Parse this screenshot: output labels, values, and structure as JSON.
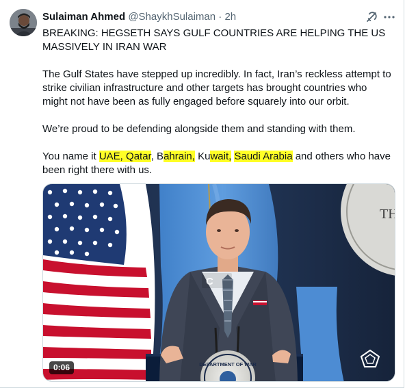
{
  "tweet": {
    "author_name": "Sulaiman Ahmed",
    "handle": "@ShaykhSulaiman",
    "separator": "·",
    "time": "2h",
    "headline_line1": "BREAKING: HEGSETH SAYS GULF COUNTRIES ARE HELPING THE US",
    "headline_line2": "MASSIVELY IN IRAN WAR",
    "paragraph1": "The Gulf States have stepped up incredibly. In fact, Iran’s reckless attempt to strike civilian infrastructure and other targets has brought countries who might not have been as fully engaged before squarely into our orbit.",
    "paragraph2": "We’re proud to be defending alongside them and standing with them.",
    "p3": {
      "t1": "You name it ",
      "h1": "UAE, Qatar",
      "t2": ", B",
      "h2": "ahrain,",
      "t3": " Ku",
      "h3": "wait,",
      "t4": " ",
      "h4": "Saudi Arabia",
      "t5": " and others who have been right there with us."
    }
  },
  "video": {
    "timestamp": "0:06",
    "watermark": "C",
    "backdrop_letter": "TH",
    "seal_text": "DEPARTMENT OF WAR"
  },
  "icons": {
    "grok": "grok-icon",
    "more": "more-options-icon",
    "seal": "department-seal-icon",
    "pentagon": "pentagon-logo-icon"
  },
  "colors": {
    "highlight": "#ffff26",
    "muted_text": "#536471",
    "border": "#cfd9de"
  }
}
